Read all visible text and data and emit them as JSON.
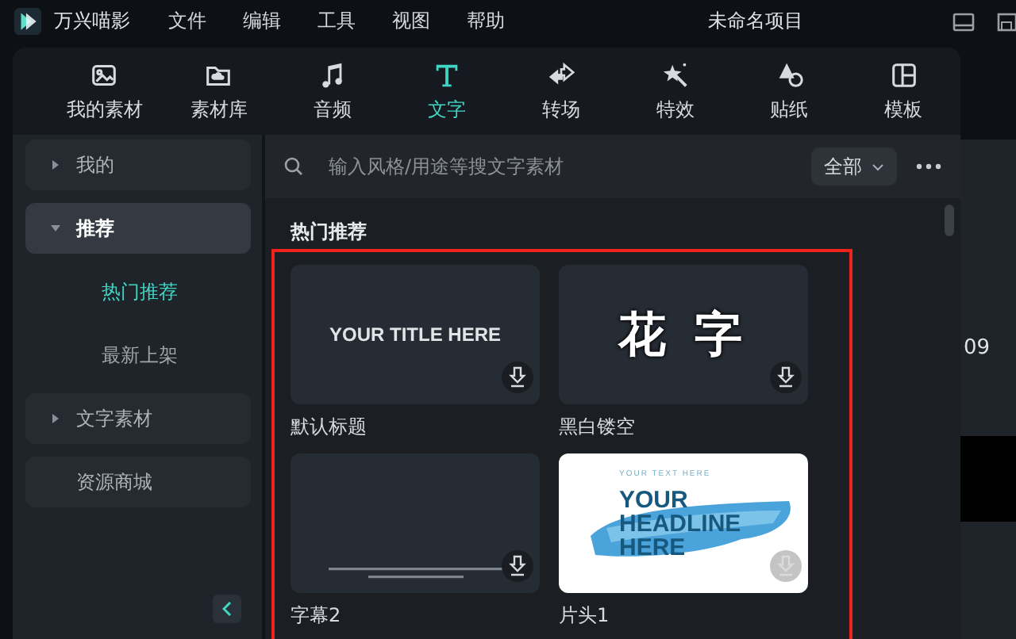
{
  "app": {
    "name": "万兴喵影"
  },
  "menu": [
    "文件",
    "编辑",
    "工具",
    "视图",
    "帮助"
  ],
  "project_title": "未命名项目",
  "tabs": [
    {
      "label": "我的素材",
      "selected": false
    },
    {
      "label": "素材库",
      "selected": false
    },
    {
      "label": "音频",
      "selected": false
    },
    {
      "label": "文字",
      "selected": true
    },
    {
      "label": "转场",
      "selected": false
    },
    {
      "label": "特效",
      "selected": false
    },
    {
      "label": "贴纸",
      "selected": false
    },
    {
      "label": "模板",
      "selected": false
    }
  ],
  "sidebar": {
    "items": [
      {
        "label": "我的",
        "expanded": false,
        "selected": false
      },
      {
        "label": "推荐",
        "expanded": true,
        "selected": true,
        "children": [
          {
            "label": "热门推荐",
            "selected": true
          },
          {
            "label": "最新上架",
            "selected": false
          }
        ]
      },
      {
        "label": "文字素材",
        "expanded": false,
        "selected": false
      },
      {
        "label": "资源商城",
        "selected": false
      }
    ]
  },
  "search": {
    "placeholder": "输入风格/用途等搜文字素材"
  },
  "filter": {
    "value": "全部"
  },
  "section_title": "热门推荐",
  "cards": [
    {
      "title": "默认标题",
      "kind": "title",
      "preview": [
        "YOUR TITLE HERE"
      ]
    },
    {
      "title": "黑白镂空",
      "kind": "fancy",
      "preview": [
        "花 字"
      ]
    },
    {
      "title": "字幕2",
      "kind": "subtitle"
    },
    {
      "title": "片头1",
      "kind": "headline",
      "preview": [
        "YOUR TEXT HERE",
        "YOUR HEADLINE HERE"
      ]
    }
  ],
  "right_panel": {
    "text": "09"
  }
}
